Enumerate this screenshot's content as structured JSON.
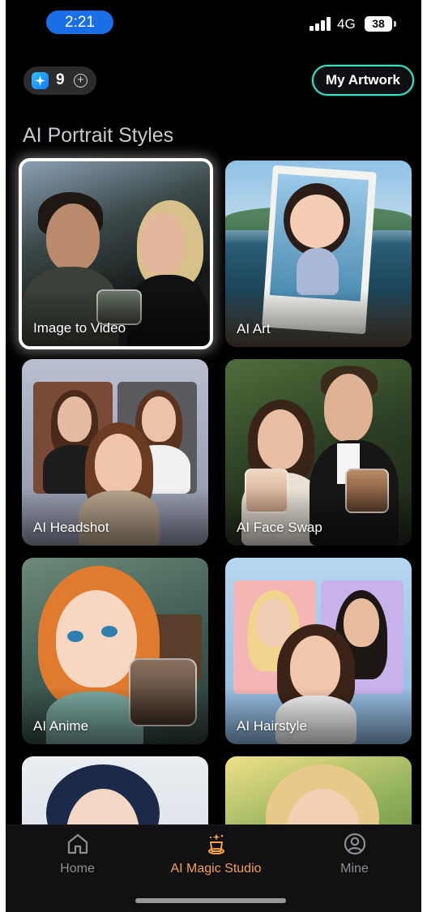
{
  "status_bar": {
    "time": "2:21",
    "network": "4G",
    "battery": "38"
  },
  "header": {
    "credits": "9",
    "credit_icon": "sparkle-icon",
    "add_icon": "plus-circle-icon",
    "my_artwork_label": "My Artwork",
    "accent_color": "#3fe0c5"
  },
  "section_title": "AI Portrait Styles",
  "styles": [
    {
      "label": "Image to Video",
      "selected": true
    },
    {
      "label": "AI Art",
      "selected": false
    },
    {
      "label": "AI Headshot",
      "selected": false
    },
    {
      "label": "AI Face Swap",
      "selected": false
    },
    {
      "label": "AI Anime",
      "selected": false
    },
    {
      "label": "AI Hairstyle",
      "selected": false
    },
    {
      "label": "",
      "selected": false
    },
    {
      "label": "",
      "selected": false
    }
  ],
  "bottom_nav": {
    "items": [
      {
        "label": "Home",
        "icon": "home-icon",
        "active": false
      },
      {
        "label": "AI Magic Studio",
        "icon": "magic-hat-icon",
        "active": true
      },
      {
        "label": "Mine",
        "icon": "user-circle-icon",
        "active": false
      }
    ],
    "active_color": "#f5a24a"
  }
}
